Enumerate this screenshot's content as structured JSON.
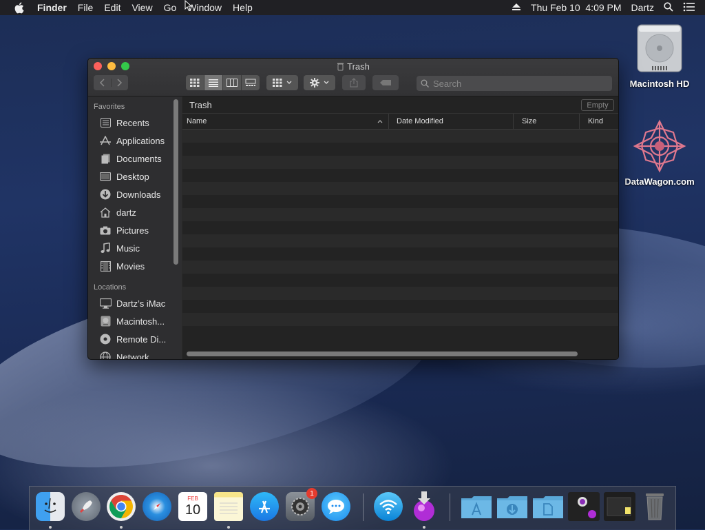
{
  "menubar": {
    "app_name": "Finder",
    "menus": [
      "File",
      "Edit",
      "View",
      "Go",
      "Window",
      "Help"
    ],
    "datetime": "Thu Feb 10  4:09 PM",
    "user": "Dartz"
  },
  "desktop": {
    "icons": [
      {
        "label": "Macintosh HD"
      },
      {
        "label": "DataWagon.com"
      }
    ]
  },
  "window": {
    "title": "Trash",
    "search_placeholder": "Search",
    "path_label": "Trash",
    "empty_button": "Empty",
    "columns": [
      "Name",
      "Date Modified",
      "Size",
      "Kind"
    ]
  },
  "sidebar": {
    "favorites_heading": "Favorites",
    "favorites": [
      "Recents",
      "Applications",
      "Documents",
      "Desktop",
      "Downloads",
      "dartz",
      "Pictures",
      "Music",
      "Movies"
    ],
    "locations_heading": "Locations",
    "locations": [
      "Dartz’s iMac",
      "Macintosh...",
      "Remote Di...",
      "Network"
    ]
  },
  "dock": {
    "calendar_month": "FEB",
    "calendar_day": "10",
    "notification_badge": "1"
  },
  "colors": {
    "close": "#fc605b",
    "minimize": "#fdbc40",
    "zoom": "#34c84a",
    "badge": "#e63b2e"
  }
}
